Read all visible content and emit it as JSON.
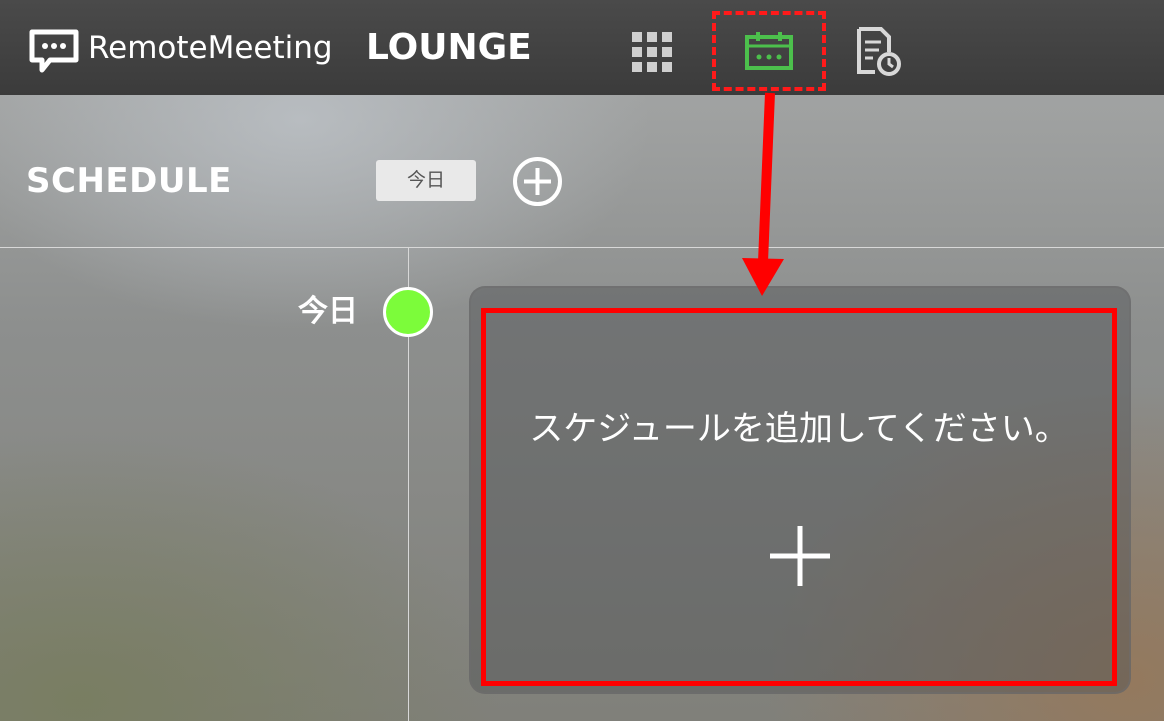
{
  "header": {
    "brand": "RemoteMeeting",
    "app_name": "LOUNGE",
    "nav": [
      {
        "icon": "grid-icon"
      },
      {
        "icon": "calendar-icon",
        "active": true
      },
      {
        "icon": "history-document-icon"
      }
    ]
  },
  "schedule": {
    "title": "SCHEDULE",
    "today_button": "今日",
    "add_icon": "plus-circle-icon"
  },
  "timeline": {
    "day_label": "今日",
    "empty_message": "スケジュールを追加してください。",
    "add_icon": "plus-icon"
  },
  "colors": {
    "topbar": "#3f3f3f",
    "active_icon": "#4cc04c",
    "status_dot": "#7cfc3a",
    "annotation": "#ff0000"
  }
}
